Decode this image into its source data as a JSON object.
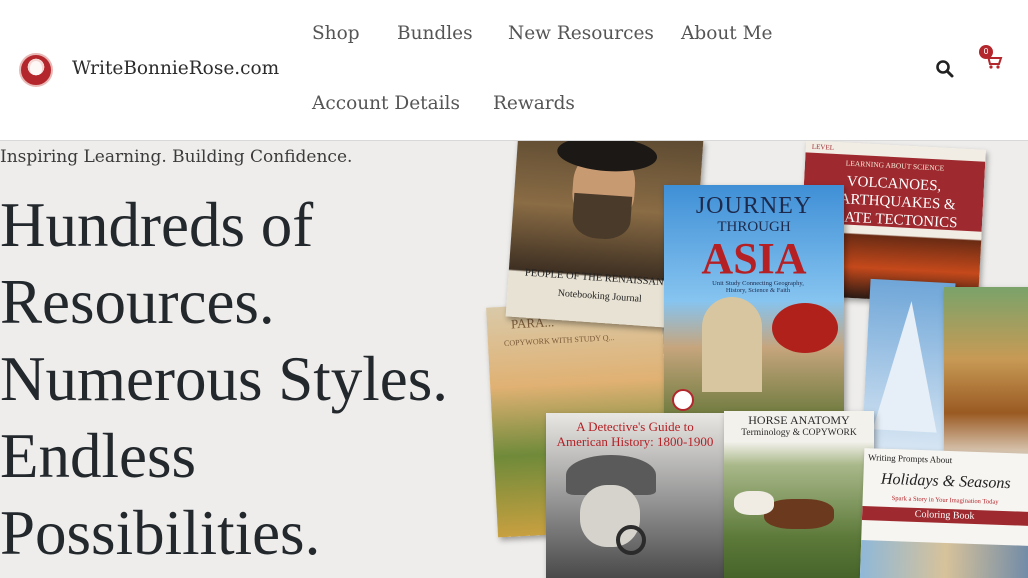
{
  "site": {
    "title": "WriteBonnieRose.com"
  },
  "nav": {
    "items": [
      {
        "label": "Shop"
      },
      {
        "label": "Bundles"
      },
      {
        "label": "New Resources"
      },
      {
        "label": "About Me"
      },
      {
        "label": "Account Details"
      },
      {
        "label": "Rewards"
      }
    ]
  },
  "cart": {
    "count": "0"
  },
  "icons": {
    "search": "search-icon",
    "cart": "cart-icon"
  },
  "hero": {
    "tagline": "Inspiring Learning. Building Confidence.",
    "headline_lines": [
      "Hundreds of",
      "Resources.",
      "Numerous Styles.",
      "Endless",
      "Possibilities."
    ]
  },
  "books": {
    "renaissance": {
      "title": "PEOPLE OF THE RENAISSANCE",
      "subtitle": "Notebooking Journal"
    },
    "asia": {
      "line1": "JOURNEY",
      "line2": "THROUGH",
      "line3": "ASIA",
      "subtitle": "Unit Study Connecting Geography, History, Science & Faith"
    },
    "volcanoes": {
      "level": "LEVEL",
      "series": "LEARNING ABOUT SCIENCE",
      "title": "VOLCANOES, EARTHQUAKES & PLATE TECTONICS"
    },
    "parables": {
      "title": "PARA...",
      "subtitle": "COPYWORK WITH STUDY Q..."
    },
    "detective": {
      "title": "A Detective's Guide to American History: 1800-1900"
    },
    "anatomy": {
      "title": "HORSE ANATOMY",
      "subtitle": "Terminology & COPYWORK"
    },
    "holidays": {
      "top": "Writing Prompts About",
      "title": "Holidays & Seasons",
      "subtitle": "Spark a Story in Your Imagination Today",
      "coloring": "Coloring Book"
    }
  },
  "colors": {
    "accent": "#b3262c",
    "text": "#23282d",
    "nav": "#555555"
  }
}
